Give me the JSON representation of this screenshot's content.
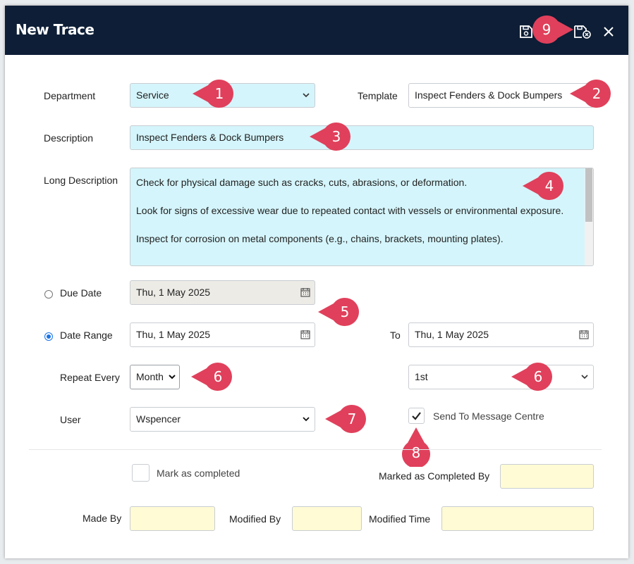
{
  "window": {
    "title": "New Trace"
  },
  "form": {
    "department": {
      "label": "Department",
      "value": "Service"
    },
    "template": {
      "label": "Template",
      "value": "Inspect Fenders &  Dock Bumpers"
    },
    "description": {
      "label": "Description",
      "value": "Inspect Fenders &  Dock Bumpers"
    },
    "long_description": {
      "label": "Long Description",
      "paragraphs": [
        "Check for physical damage such as cracks, cuts, abrasions, or deformation.",
        "Look for signs of excessive wear due to repeated contact with vessels or environmental exposure.",
        "Inspect for corrosion on metal components (e.g., chains, brackets, mounting plates)."
      ]
    },
    "due_date": {
      "label": "Due Date",
      "value": "Thu, 1 May 2025",
      "selected": false
    },
    "date_range": {
      "label": "Date Range",
      "from": "Thu, 1 May 2025",
      "to_label": "To",
      "to": "Thu, 1 May 2025",
      "selected": true
    },
    "repeat_every": {
      "label": "Repeat Every",
      "value": "Month",
      "day_value": "1st"
    },
    "user": {
      "label": "User",
      "value": "Wspencer"
    },
    "send_to_message_centre": {
      "label": "Send To Message Centre",
      "checked": true
    },
    "mark_completed": {
      "label": "Mark as completed",
      "checked": false
    },
    "marked_completed_by": {
      "label": "Marked as Completed By",
      "value": ""
    },
    "made_by": {
      "label": "Made By",
      "value": ""
    },
    "modified_by": {
      "label": "Modified By",
      "value": ""
    },
    "modified_time": {
      "label": "Modified Time",
      "value": ""
    }
  },
  "annotations": {
    "color": "#e0405b",
    "markers": [
      "1",
      "2",
      "3",
      "4",
      "5",
      "6",
      "6",
      "7",
      "8",
      "9"
    ]
  },
  "icons": [
    "save-icon",
    "save-close-icon",
    "close-icon",
    "chevron-down-icon",
    "calendar-icon",
    "checkmark-icon"
  ]
}
